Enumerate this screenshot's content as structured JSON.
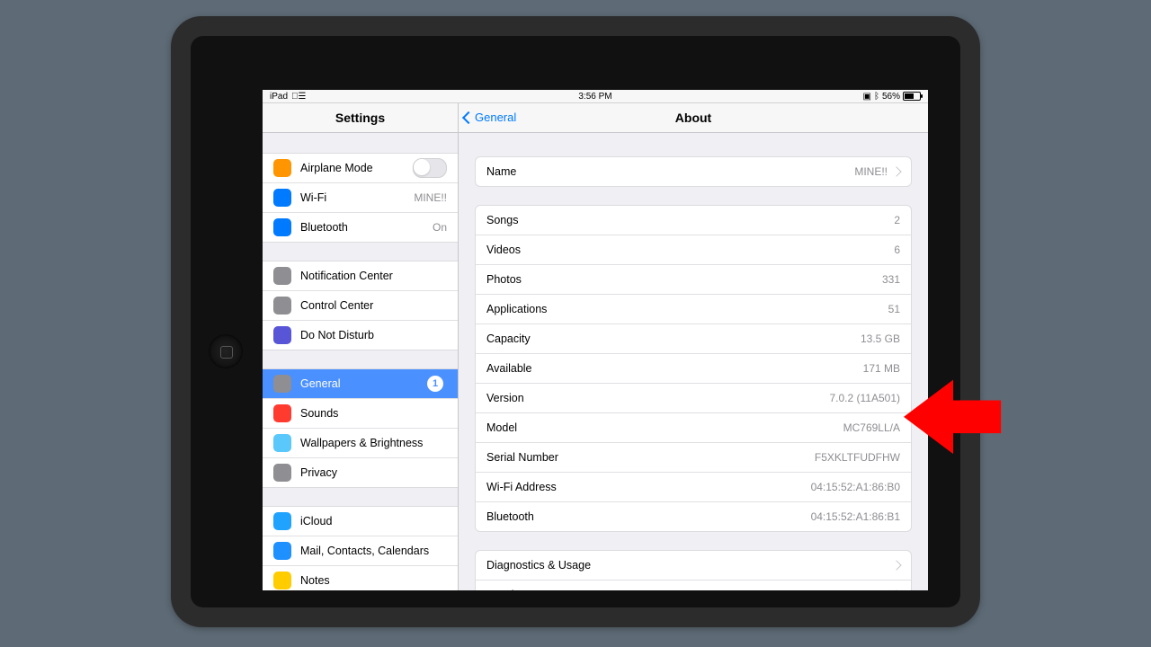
{
  "status": {
    "device": "iPad",
    "time": "3:56 PM",
    "battery_pct": "56%"
  },
  "header": {
    "left": "Settings",
    "back": "General",
    "title": "About"
  },
  "sidebar": {
    "g1": [
      {
        "icon_bg": "#ff9500",
        "label": "Airplane Mode",
        "toggle": true
      },
      {
        "icon_bg": "#007aff",
        "label": "Wi-Fi",
        "value": "MINE!!"
      },
      {
        "icon_bg": "#007aff",
        "label": "Bluetooth",
        "value": "On"
      }
    ],
    "g2": [
      {
        "icon_bg": "#8e8e93",
        "label": "Notification Center"
      },
      {
        "icon_bg": "#8e8e93",
        "label": "Control Center"
      },
      {
        "icon_bg": "#5856d6",
        "label": "Do Not Disturb"
      }
    ],
    "g3": [
      {
        "icon_bg": "#8e8e93",
        "label": "General",
        "badge": "1",
        "selected": true
      },
      {
        "icon_bg": "#ff3b30",
        "label": "Sounds"
      },
      {
        "icon_bg": "#5ac8fa",
        "label": "Wallpapers & Brightness"
      },
      {
        "icon_bg": "#8e8e93",
        "label": "Privacy"
      }
    ],
    "g4": [
      {
        "icon_bg": "#20a3ff",
        "label": "iCloud"
      },
      {
        "icon_bg": "#1e90ff",
        "label": "Mail, Contacts, Calendars"
      },
      {
        "icon_bg": "#ffcc00",
        "label": "Notes"
      }
    ]
  },
  "detail": {
    "name": {
      "label": "Name",
      "value": "MINE!!"
    },
    "info": [
      {
        "label": "Songs",
        "value": "2"
      },
      {
        "label": "Videos",
        "value": "6"
      },
      {
        "label": "Photos",
        "value": "331"
      },
      {
        "label": "Applications",
        "value": "51"
      },
      {
        "label": "Capacity",
        "value": "13.5 GB"
      },
      {
        "label": "Available",
        "value": "171 MB"
      },
      {
        "label": "Version",
        "value": "7.0.2 (11A501)"
      },
      {
        "label": "Model",
        "value": "MC769LL/A"
      },
      {
        "label": "Serial Number",
        "value": "F5XKLTFUDFHW"
      },
      {
        "label": "Wi-Fi Address",
        "value": "04:15:52:A1:86:B0"
      },
      {
        "label": "Bluetooth",
        "value": "04:15:52:A1:86:B1"
      }
    ],
    "links": [
      {
        "label": "Diagnostics & Usage"
      },
      {
        "label": "Legal"
      }
    ]
  }
}
